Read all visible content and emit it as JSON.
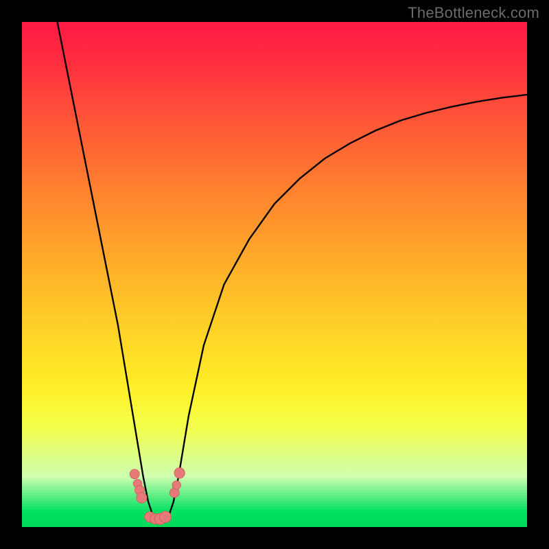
{
  "watermark": "TheBottleneck.com",
  "colors": {
    "frame": "#000000",
    "curve_stroke": "#000000",
    "marker_fill": "#e77a78",
    "marker_stroke": "#cf5a58"
  },
  "chart_data": {
    "type": "line",
    "title": "",
    "xlabel": "",
    "ylabel": "",
    "xlim": [
      0,
      100
    ],
    "ylim": [
      0,
      100
    ],
    "curve": {
      "x": [
        7,
        9,
        11,
        13,
        15,
        17,
        19,
        21,
        22,
        23,
        24,
        25,
        26,
        27,
        28,
        29,
        30,
        31,
        33,
        36,
        40,
        45,
        50,
        55,
        60,
        65,
        70,
        75,
        80,
        85,
        90,
        95,
        100
      ],
      "y": [
        100,
        90,
        80,
        70,
        60,
        50,
        40,
        28,
        22,
        16,
        10,
        5,
        2,
        1,
        1,
        2,
        5,
        10,
        22,
        36,
        48,
        57,
        64,
        69,
        73,
        76,
        78.5,
        80.5,
        82,
        83.2,
        84.2,
        85,
        85.6
      ]
    },
    "markers": [
      {
        "x": 22.3,
        "y": 10.5,
        "r": 1.0
      },
      {
        "x": 22.9,
        "y": 8.6,
        "r": 0.9
      },
      {
        "x": 23.3,
        "y": 7.3,
        "r": 1.0
      },
      {
        "x": 23.7,
        "y": 5.8,
        "r": 1.1
      },
      {
        "x": 25.3,
        "y": 2.0,
        "r": 1.1
      },
      {
        "x": 26.4,
        "y": 1.6,
        "r": 1.1
      },
      {
        "x": 27.4,
        "y": 1.6,
        "r": 1.2
      },
      {
        "x": 28.4,
        "y": 2.0,
        "r": 1.2
      },
      {
        "x": 30.2,
        "y": 6.8,
        "r": 1.0
      },
      {
        "x": 30.6,
        "y": 8.3,
        "r": 0.9
      },
      {
        "x": 31.2,
        "y": 10.7,
        "r": 1.1
      }
    ]
  }
}
